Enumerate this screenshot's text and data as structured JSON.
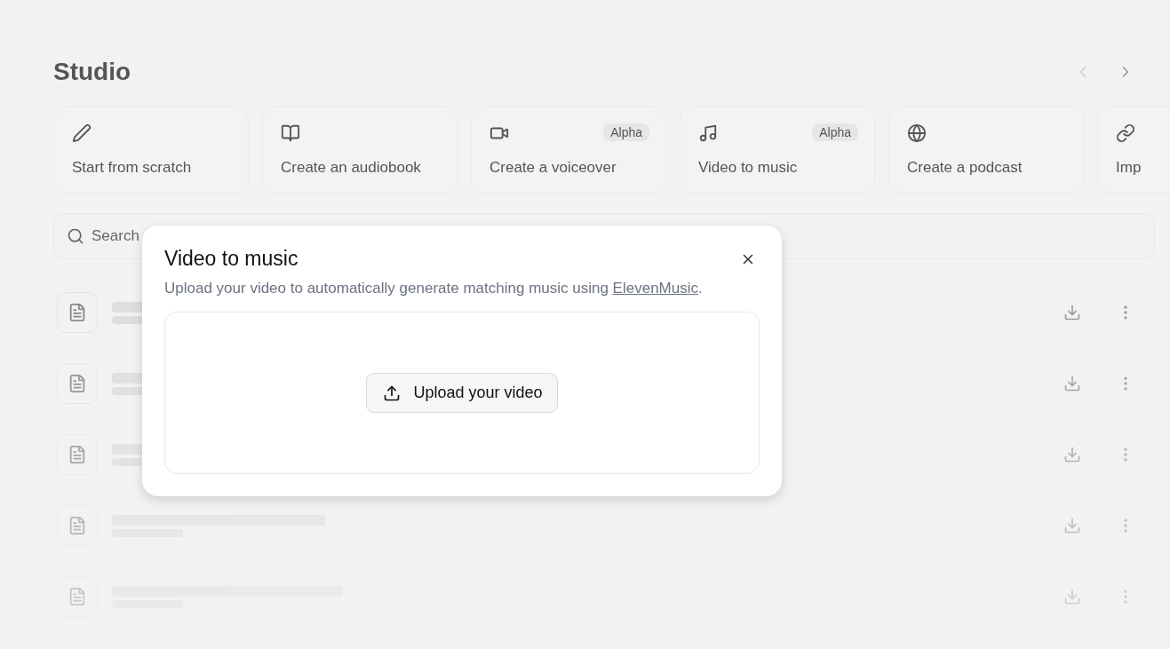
{
  "page": {
    "title": "Studio",
    "cards": [
      {
        "label": "Start from scratch"
      },
      {
        "label": "Create an audiobook"
      },
      {
        "label": "Create a voiceover",
        "badge": "Alpha"
      },
      {
        "label": "Video to music",
        "badge": "Alpha"
      },
      {
        "label": "Create a podcast"
      },
      {
        "label": "Imp"
      }
    ],
    "search": {
      "placeholder": "Search"
    },
    "rows": [
      {
        "kind": "document"
      },
      {
        "kind": "document"
      },
      {
        "kind": "document"
      },
      {
        "kind": "document"
      },
      {
        "kind": "document"
      }
    ]
  },
  "dialog": {
    "title": "Video to music",
    "description_before": "Upload your video to automatically generate matching music using ",
    "link": "ElevenMusic",
    "description_after": ".",
    "upload_button": "Upload your video"
  }
}
